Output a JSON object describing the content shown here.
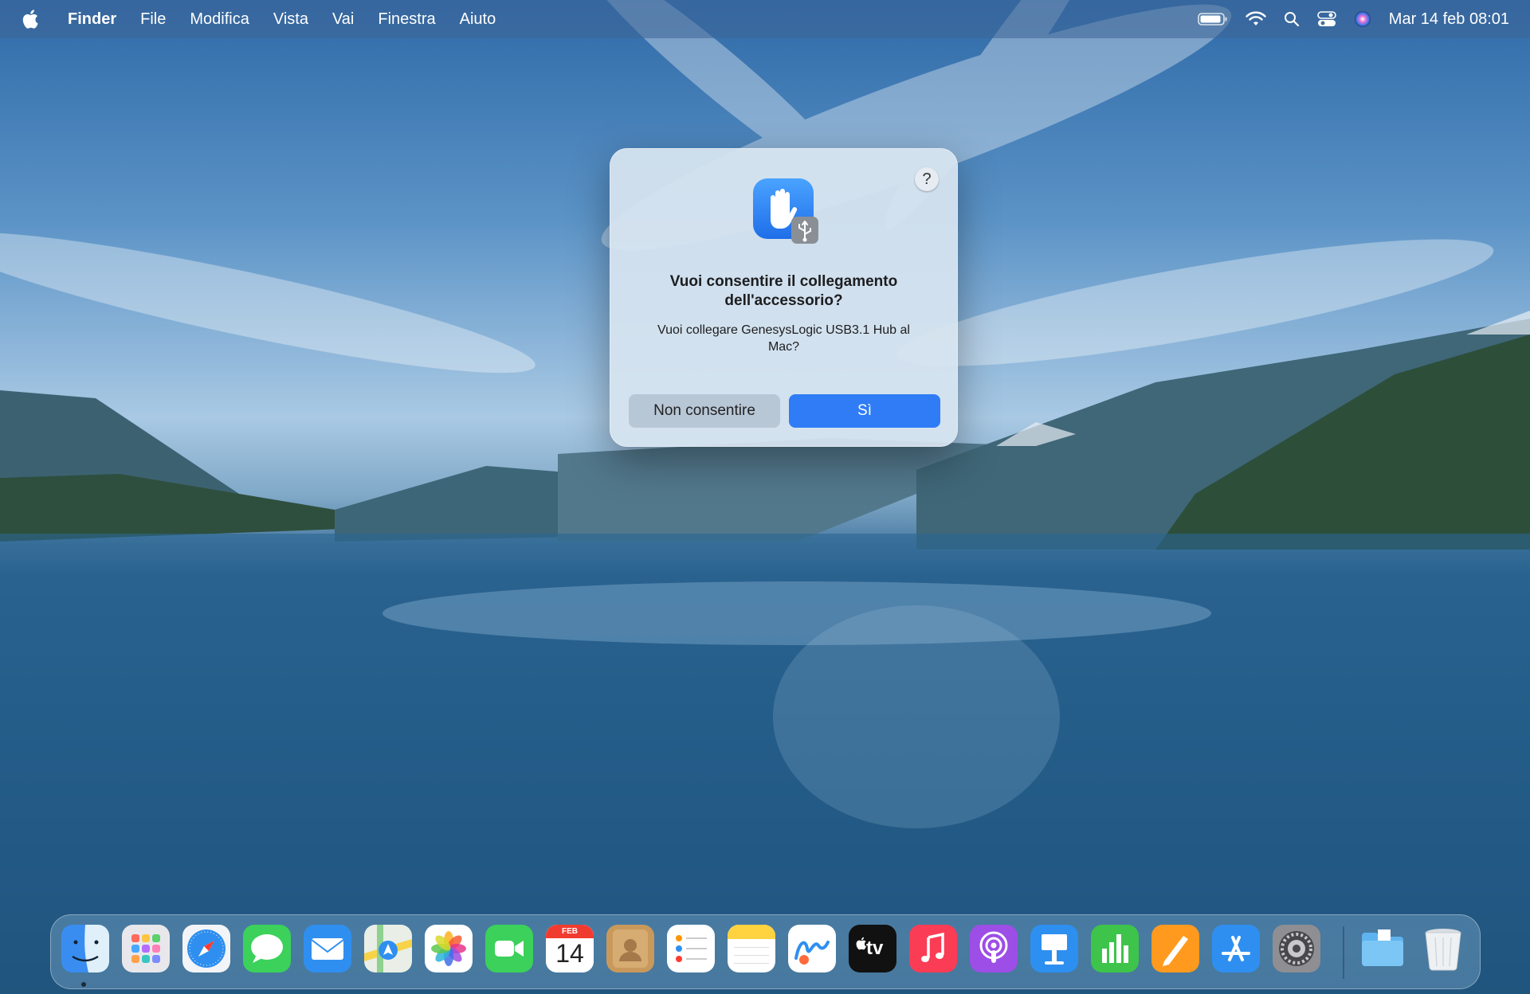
{
  "menubar": {
    "apple_icon": "apple-logo-icon",
    "app_name": "Finder",
    "menus": [
      "File",
      "Modifica",
      "Vista",
      "Vai",
      "Finestra",
      "Aiuto"
    ],
    "status_icons": [
      "battery-icon",
      "wifi-icon",
      "search-icon",
      "control-center-icon",
      "siri-icon"
    ],
    "clock": "Mar 14 feb  08:01"
  },
  "dialog": {
    "icon": "usb-accessory-hand-icon",
    "help_label": "?",
    "title": "Vuoi consentire il collegamento dell'accessorio?",
    "message": "Vuoi collegare GenesysLogic USB3.1 Hub al Mac?",
    "deny_label": "Non consentire",
    "allow_label": "Sì",
    "accent_color": "#2f7cf6"
  },
  "dock": {
    "apps": [
      "Finder",
      "Launchpad",
      "Safari",
      "Messaggi",
      "Mail",
      "Mappe",
      "Foto",
      "FaceTime",
      "Calendario",
      "Contatti",
      "Promemoria",
      "Note",
      "Freeform",
      "Apple TV",
      "Musica",
      "Podcast",
      "Keynote",
      "Numbers",
      "Pages",
      "App Store",
      "Impostazioni di Sistema",
      "Downloads",
      "Cestino"
    ],
    "calendar_month": "FEB",
    "calendar_day": "14",
    "appletv_label": "tv"
  }
}
